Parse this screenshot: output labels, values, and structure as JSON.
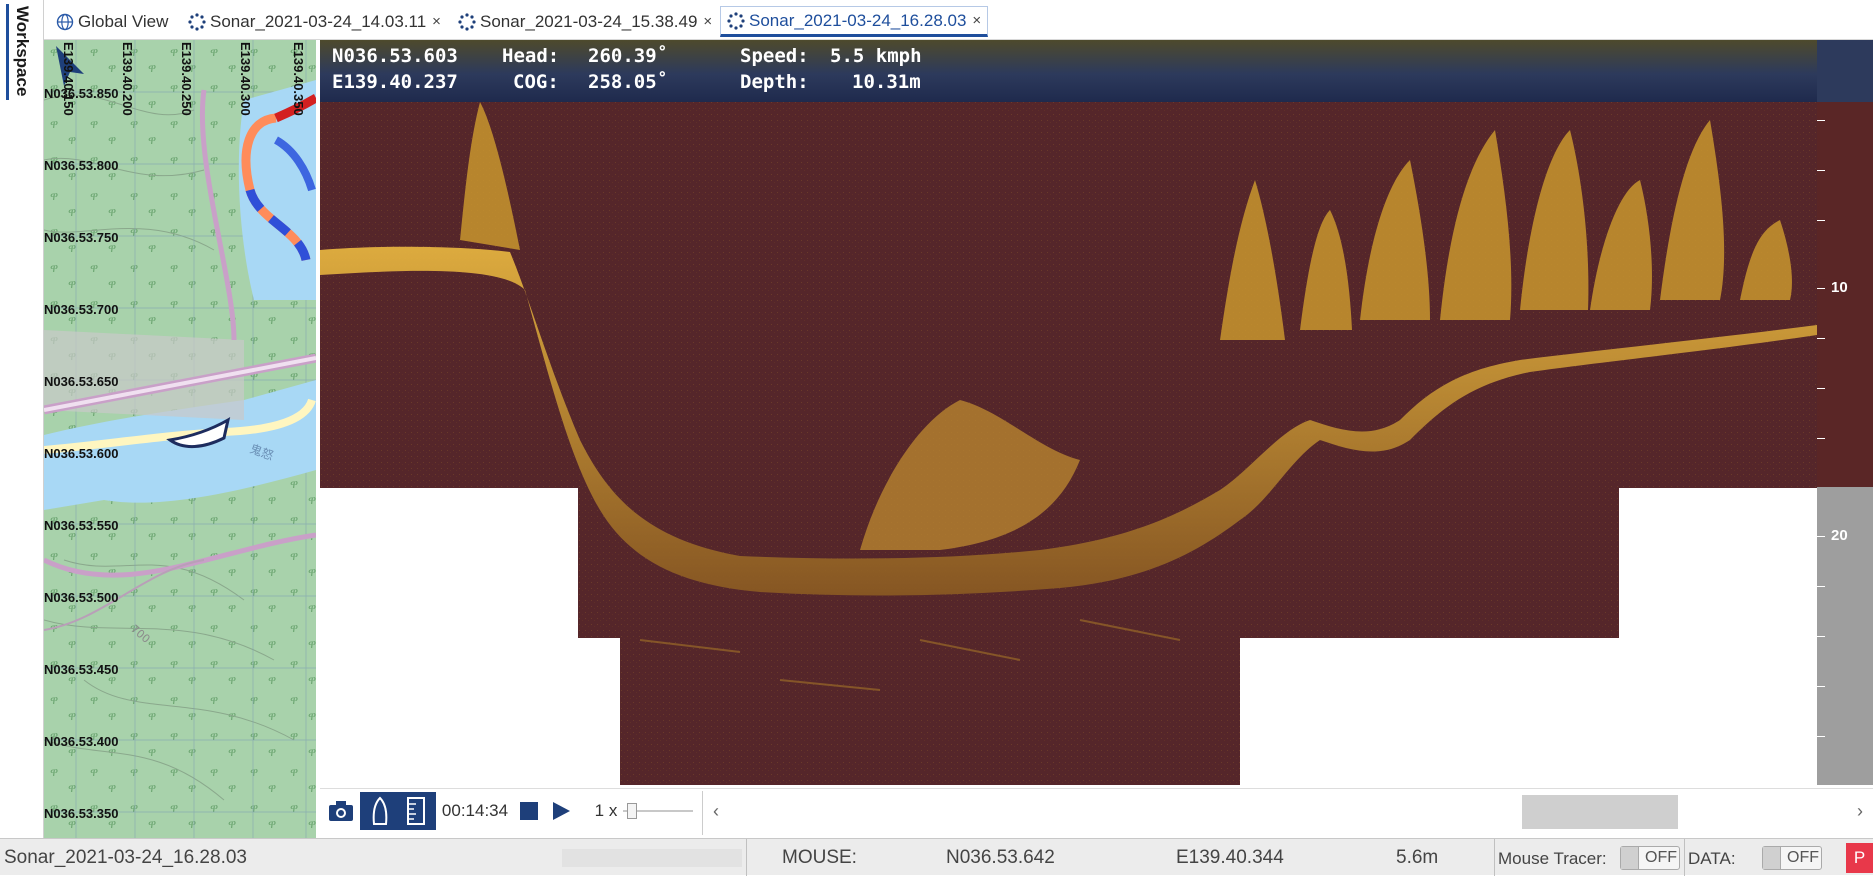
{
  "workspace": {
    "label": "Workspace"
  },
  "tabs": [
    {
      "label": "Global View",
      "icon": "globe-icon",
      "closable": false,
      "active": false
    },
    {
      "label": "Sonar_2021-03-24_14.03.11",
      "icon": "sonar-icon",
      "closable": true,
      "active": false
    },
    {
      "label": "Sonar_2021-03-24_15.38.49",
      "icon": "sonar-icon",
      "closable": true,
      "active": false
    },
    {
      "label": "Sonar_2021-03-24_16.28.03",
      "icon": "sonar-icon",
      "closable": true,
      "active": true
    }
  ],
  "tab_close_glyph": "×",
  "map": {
    "lon_labels": [
      "E139.40.150",
      "E139.40.200",
      "E139.40.250",
      "E139.40.300",
      "E139.40.350"
    ],
    "lat_labels": [
      "N036.53.850",
      "N036.53.800",
      "N036.53.750",
      "N036.53.700",
      "N036.53.650",
      "N036.53.600",
      "N036.53.550",
      "N036.53.500",
      "N036.53.450",
      "N036.53.400",
      "N036.53.350"
    ],
    "place_label": "鬼怒",
    "contour_label": "700"
  },
  "sonar": {
    "lat": "N036.53.603",
    "lon": "E139.40.237",
    "head_label": "Head:",
    "head_value": "260.39˚",
    "cog_label": "COG:",
    "cog_value": "258.05˚",
    "speed_label": "Speed:",
    "speed_value": "5.5 kmph",
    "depth_label": "Depth:",
    "depth_value": "10.31m",
    "depth_scale": [
      "10",
      "20"
    ],
    "colors": {
      "background": "#55262a",
      "echo": "#d9a62e",
      "header": "#2b3558"
    }
  },
  "controls": {
    "time": "00:14:34",
    "speed": "1 x",
    "buttons": [
      "camera-icon",
      "boat-icon",
      "ruler-icon",
      "stop-icon",
      "play-icon"
    ]
  },
  "status": {
    "file": "Sonar_2021-03-24_16.28.03",
    "mouse_label": "MOUSE:",
    "mouse_lat": "N036.53.642",
    "mouse_lon": "E139.40.344",
    "mouse_depth": "5.6m",
    "tracer_label": "Mouse Tracer:",
    "tracer_state": "OFF",
    "data_label": "DATA:",
    "data_state": "OFF",
    "rec_label": "P"
  }
}
